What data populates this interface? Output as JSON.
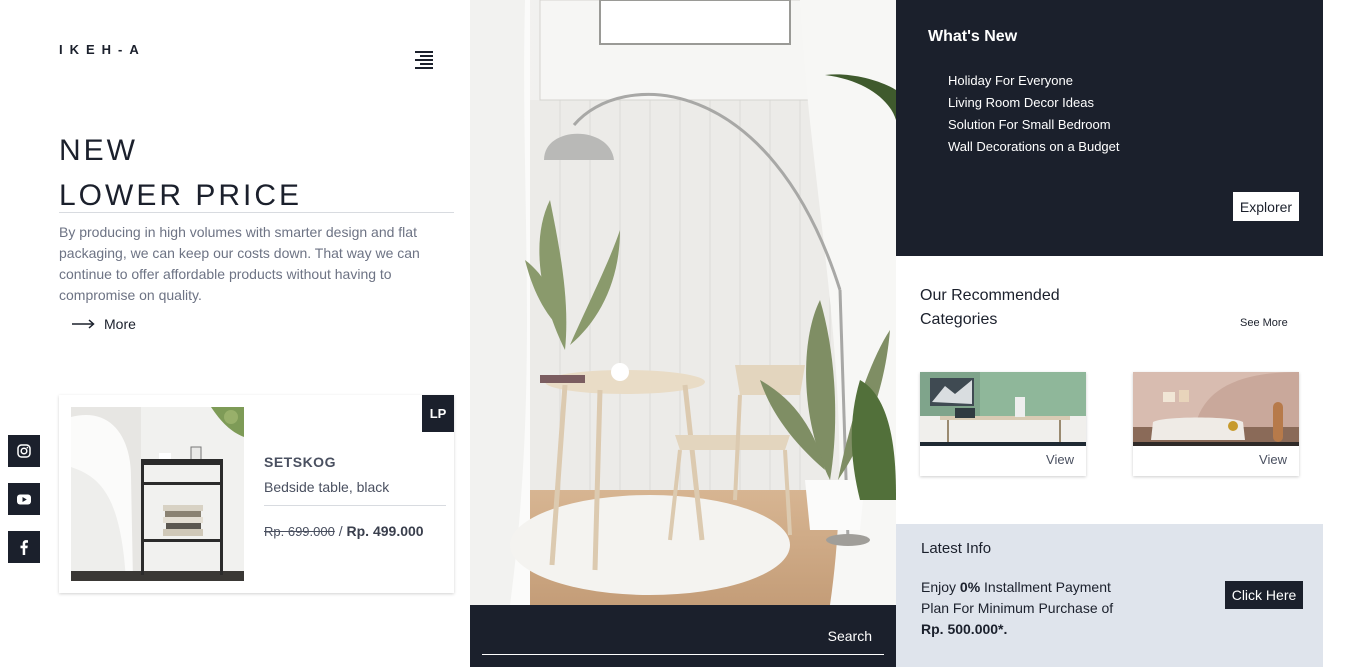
{
  "brand": {
    "logo": "IKEH-A"
  },
  "hero": {
    "line1": "NEW",
    "line2": "LOWER PRICE",
    "description": "By producing in high volumes with smarter design and flat packaging, we can keep our costs down. That way we can continue to offer affordable products without having to compromise on quality.",
    "more_label": "More"
  },
  "product": {
    "badge": "LP",
    "name": "SETSKOG",
    "subtitle": "Bedside table, black",
    "old_price": "Rp. 699.000",
    "separator": " / ",
    "new_price": "Rp. 499.000"
  },
  "search": {
    "label": "Search"
  },
  "whats_new": {
    "title": "What's New",
    "items": [
      "Holiday For Everyone",
      "Living Room Decor Ideas",
      "Solution For Small Bedroom",
      "Wall Decorations on a Budget"
    ],
    "button": "Explorer"
  },
  "recommended": {
    "title": "Our Recommended Categories",
    "see_more": "See More",
    "cards": [
      {
        "action": "View"
      },
      {
        "action": "View"
      }
    ]
  },
  "latest": {
    "title": "Latest Info",
    "text_pre": "Enjoy ",
    "text_bold": "0%",
    "text_mid": " Installment Payment Plan For Minimum Purchase of ",
    "text_bold2": "Rp. 500.000*.",
    "button": "Click Here"
  },
  "icons": {
    "social": [
      "instagram-icon",
      "youtube-icon",
      "facebook-icon"
    ],
    "menu": "menu-icon"
  },
  "colors": {
    "dark": "#1b202c",
    "light_panel": "#dfe4ec",
    "text_muted": "#6d7384"
  }
}
